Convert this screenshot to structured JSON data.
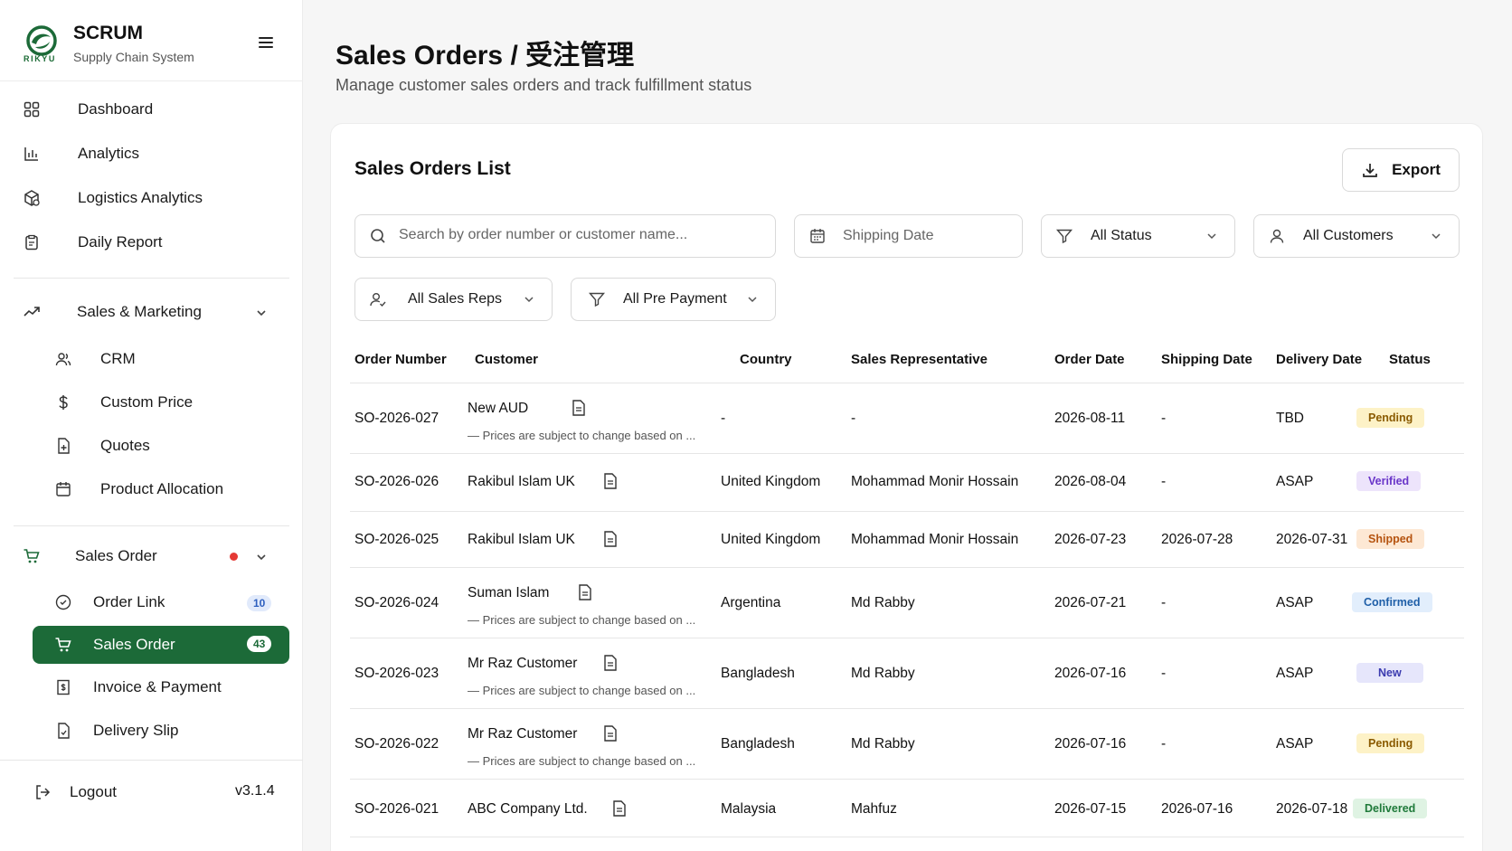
{
  "brand": {
    "logo_text": "RIKYU",
    "title": "SCRUM",
    "subtitle": "Supply Chain System"
  },
  "sidebar": {
    "items": [
      {
        "label": "Dashboard",
        "icon": "grid-icon"
      },
      {
        "label": "Analytics",
        "icon": "bar-chart-icon"
      },
      {
        "label": "Logistics Analytics",
        "icon": "package-icon"
      },
      {
        "label": "Daily Report",
        "icon": "clipboard-icon"
      }
    ],
    "sales_marketing": {
      "label": "Sales & Marketing",
      "items": [
        {
          "label": "CRM",
          "icon": "users-icon"
        },
        {
          "label": "Custom Price",
          "icon": "dollar-icon"
        },
        {
          "label": "Quotes",
          "icon": "file-plus-icon"
        },
        {
          "label": "Product Allocation",
          "icon": "calendar-icon"
        }
      ]
    },
    "sales_order": {
      "label": "Sales Order",
      "items": [
        {
          "label": "Order Link",
          "icon": "check-circle-icon",
          "badge": "10"
        },
        {
          "label": "Sales Order",
          "icon": "cart-icon",
          "badge": "43",
          "active": true
        },
        {
          "label": "Invoice & Payment",
          "icon": "receipt-icon"
        },
        {
          "label": "Delivery Slip",
          "icon": "file-icon"
        }
      ]
    },
    "logout": "Logout",
    "version": "v3.1.4"
  },
  "header": {
    "title": "Sales Orders / 受注管理",
    "subtitle": "Manage customer sales orders and track fulfillment status"
  },
  "card": {
    "title": "Sales Orders List",
    "export_label": "Export",
    "filters": {
      "search_placeholder": "Search by order number or customer name...",
      "shipping_date": "Shipping Date",
      "status": "All Status",
      "customers": "All Customers",
      "sales_reps": "All Sales Reps",
      "pre_payment": "All Pre Payment"
    },
    "columns": [
      "Order Number",
      "Customer",
      "Country",
      "Sales Representative",
      "Order Date",
      "Shipping Date",
      "Delivery Date",
      "Status"
    ],
    "rows": [
      {
        "order": "SO-2026-027",
        "customer": "New AUD",
        "note": "— Prices are subject to change based on ...",
        "country": "-",
        "rep": "-",
        "order_date": "2026-08-11",
        "ship_date": "-",
        "delivery": "TBD",
        "status": "Pending"
      },
      {
        "order": "SO-2026-026",
        "customer": "Rakibul Islam UK",
        "note": "",
        "country": "United Kingdom",
        "rep": "Mohammad Monir Hossain",
        "order_date": "2026-08-04",
        "ship_date": "-",
        "delivery": "ASAP",
        "status": "Verified"
      },
      {
        "order": "SO-2026-025",
        "customer": "Rakibul Islam UK",
        "note": "",
        "country": "United Kingdom",
        "rep": "Mohammad Monir Hossain",
        "order_date": "2026-07-23",
        "ship_date": "2026-07-28",
        "delivery": "2026-07-31",
        "status": "Shipped"
      },
      {
        "order": "SO-2026-024",
        "customer": "Suman Islam",
        "note": "— Prices are subject to change based on ...",
        "country": "Argentina",
        "rep": "Md Rabby",
        "order_date": "2026-07-21",
        "ship_date": "-",
        "delivery": "ASAP",
        "status": "Confirmed"
      },
      {
        "order": "SO-2026-023",
        "customer": "Mr Raz Customer",
        "note": "— Prices are subject to change based on ...",
        "country": "Bangladesh",
        "rep": "Md Rabby",
        "order_date": "2026-07-16",
        "ship_date": "-",
        "delivery": "ASAP",
        "status": "New"
      },
      {
        "order": "SO-2026-022",
        "customer": "Mr Raz Customer",
        "note": "— Prices are subject to change based on ...",
        "country": "Bangladesh",
        "rep": "Md Rabby",
        "order_date": "2026-07-16",
        "ship_date": "-",
        "delivery": "ASAP",
        "status": "Pending"
      },
      {
        "order": "SO-2026-021",
        "customer": "ABC Company Ltd.",
        "note": "",
        "country": "Malaysia",
        "rep": "Mahfuz",
        "order_date": "2026-07-15",
        "ship_date": "2026-07-16",
        "delivery": "2026-07-18",
        "status": "Delivered"
      }
    ]
  },
  "colors": {
    "brand_green": "#1c6a38",
    "pending_bg": "#fdf2c7",
    "pending_fg": "#8a5a00",
    "verified_bg": "#ede4fb",
    "verified_fg": "#6a36c9",
    "shipped_bg": "#fde8d4",
    "shipped_fg": "#b5530f",
    "confirmed_bg": "#e2eefc",
    "confirmed_fg": "#1f5fa8",
    "new_bg": "#e6e6fb",
    "new_fg": "#3b3bb0",
    "delivered_bg": "#dff3e3",
    "delivered_fg": "#1f7a3a"
  }
}
